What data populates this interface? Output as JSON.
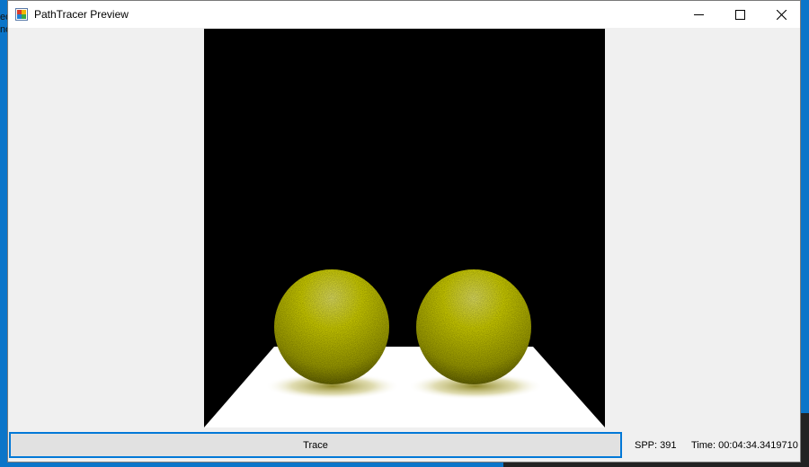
{
  "window": {
    "title": "PathTracer Preview",
    "controls": [
      "minimize-icon",
      "maximize-icon",
      "close-icon"
    ]
  },
  "desktop": {
    "background_color": "#0b75c9",
    "edge_text": [
      "ed",
      "no"
    ]
  },
  "render": {
    "background_color": "#000000",
    "floor_color": "#ffffff",
    "sphere_color": "#e8e800",
    "sphere_count": 2
  },
  "controls": {
    "trace_label": "Trace"
  },
  "status": {
    "spp_text": "SPP: 391",
    "time_text": "Time: 00:04:34.3419710"
  },
  "colors": {
    "accent": "#0078d7",
    "button_face": "#e1e1e1",
    "window_bg": "#f0f0f0"
  }
}
